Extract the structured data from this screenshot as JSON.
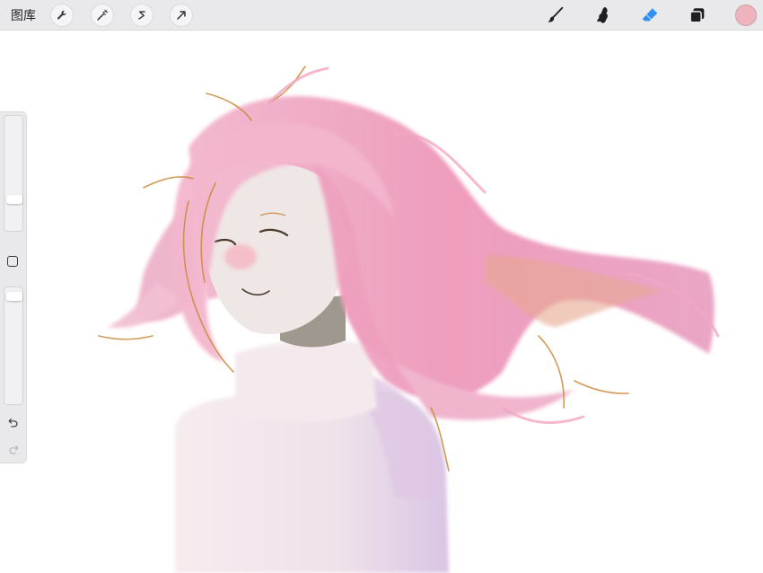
{
  "toolbar": {
    "gallery_label": "图库",
    "left_tools": [
      "wrench-icon",
      "magic-wand-icon",
      "selection-icon",
      "transform-arrow-icon"
    ],
    "right_tools": [
      "brush-icon",
      "smudge-icon",
      "eraser-icon",
      "layers-icon"
    ],
    "active_tool": "eraser",
    "active_color": "#efb3be",
    "accent": "#2f8ff5"
  },
  "sidebar": {
    "brush_size": 0.25,
    "opacity": 0.97,
    "undo_icon": "undo-icon",
    "redo_icon": "redo-icon"
  },
  "canvas": {
    "subject": "anime-style-girl-with-pink-hair-illustration"
  }
}
